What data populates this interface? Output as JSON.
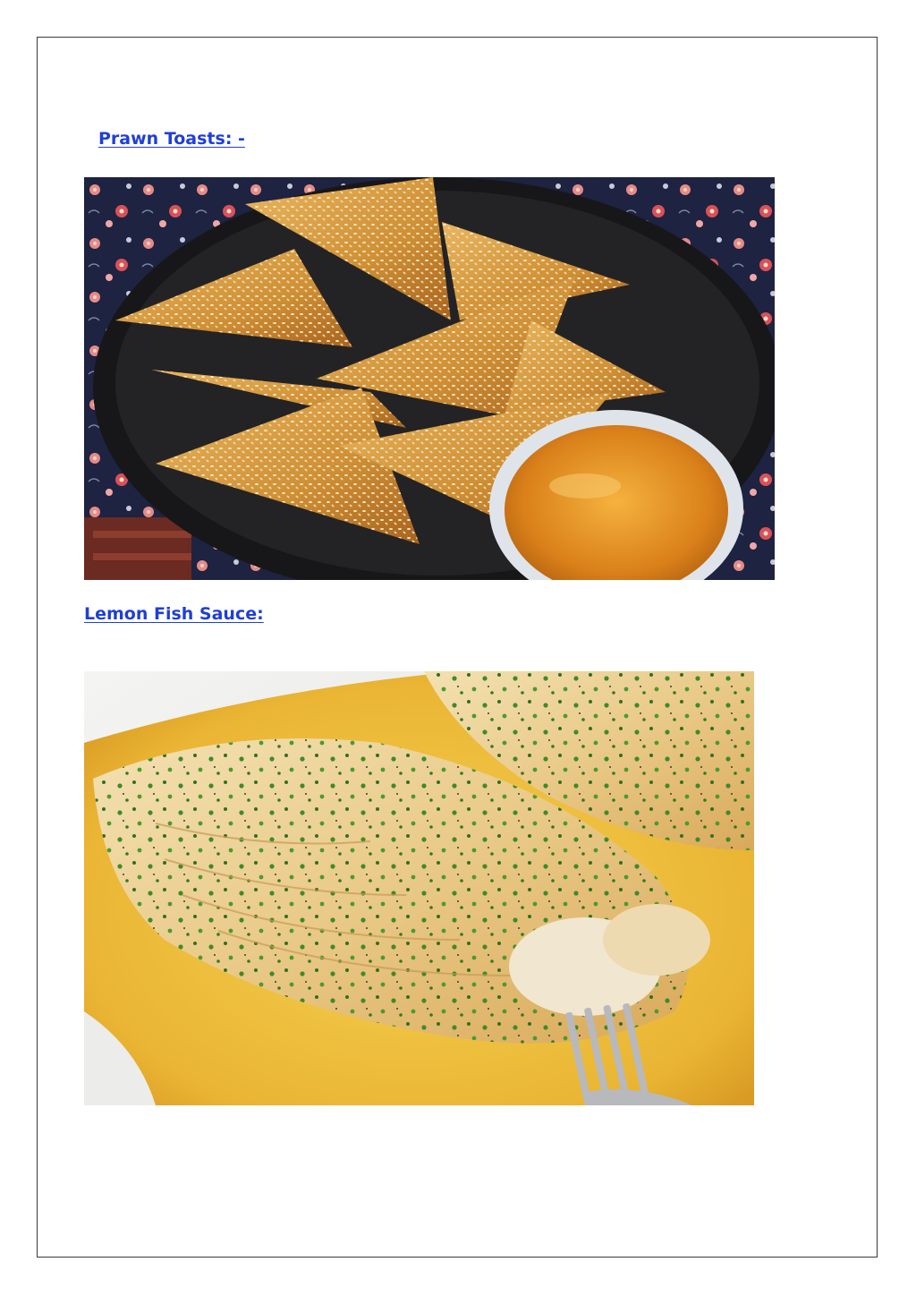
{
  "sections": [
    {
      "heading": "Prawn Toasts: -",
      "image": "prawn-toasts-photo"
    },
    {
      "heading": "Lemon Fish Sauce:",
      "image": "lemon-fish-sauce-photo"
    }
  ],
  "colors": {
    "heading_link": "#1f3fd6",
    "page_border": "#3a3a3a",
    "plate_dark": "#1c1c1e",
    "toast_gold": "#d69a3a",
    "sauce_orange": "#e08a1a",
    "fish_sauce_yellow": "#f2c238",
    "parsley_green": "#3f8a2a"
  }
}
